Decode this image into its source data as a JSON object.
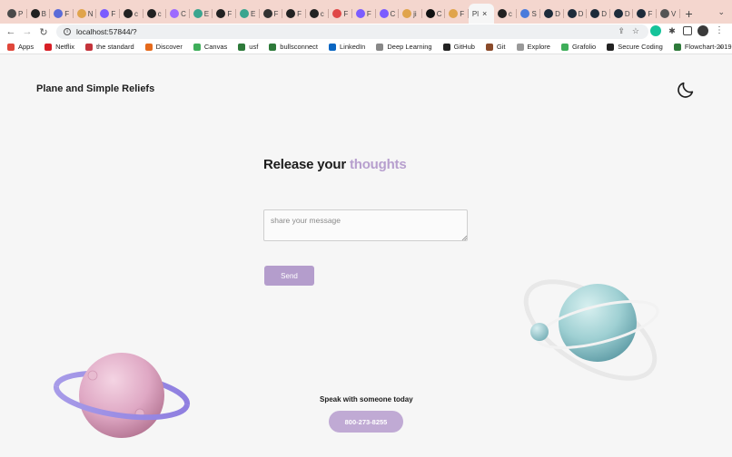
{
  "browser": {
    "tabs": [
      {
        "fav": "#4a4a4a",
        "label": "P"
      },
      {
        "fav": "#222222",
        "label": "B"
      },
      {
        "fav": "#5a6bd8",
        "label": "F"
      },
      {
        "fav": "#e0a44c",
        "label": "N"
      },
      {
        "fav": "#7b5cff",
        "label": "F"
      },
      {
        "fav": "#222222",
        "label": "c"
      },
      {
        "fav": "#222222",
        "label": "c"
      },
      {
        "fav": "#9d6bff",
        "label": "C"
      },
      {
        "fav": "#3aa58f",
        "label": "E"
      },
      {
        "fav": "#222222",
        "label": "F"
      },
      {
        "fav": "#3aa58f",
        "label": "E"
      },
      {
        "fav": "#333333",
        "label": "F"
      },
      {
        "fav": "#222222",
        "label": "F"
      },
      {
        "fav": "#222222",
        "label": "c"
      },
      {
        "fav": "#e04848",
        "label": "F"
      },
      {
        "fav": "#7b5cff",
        "label": "F"
      },
      {
        "fav": "#7b5cff",
        "label": "C"
      },
      {
        "fav": "#e0a44c",
        "label": "ji"
      },
      {
        "fav": "#111111",
        "label": "C"
      },
      {
        "fav": "#e0a44c",
        "label": "F"
      }
    ],
    "active_tab": {
      "label": "Pl",
      "close": "×"
    },
    "tabs_after": [
      {
        "fav": "#222222",
        "label": "c"
      },
      {
        "fav": "#4a7bdc",
        "label": "S"
      },
      {
        "fav": "#1d2b3a",
        "label": "D"
      },
      {
        "fav": "#1d2b3a",
        "label": "D"
      },
      {
        "fav": "#1d2b3a",
        "label": "D"
      },
      {
        "fav": "#1d2b3a",
        "label": "D"
      },
      {
        "fav": "#1d2b3a",
        "label": "F"
      },
      {
        "fav": "#555555",
        "label": "V"
      }
    ],
    "new_tab": "+",
    "tab_menu": "⌄",
    "url": "localhost:57844/?",
    "bookmarks": [
      {
        "label": "Apps",
        "color": "#e0473a"
      },
      {
        "label": "Netflix",
        "color": "#d81f26"
      },
      {
        "label": "the standard",
        "color": "#c4343b"
      },
      {
        "label": "Discover",
        "color": "#e56a1c"
      },
      {
        "label": "Canvas",
        "color": "#3fae5a"
      },
      {
        "label": "usf",
        "color": "#2e7a3a"
      },
      {
        "label": "bullsconnect",
        "color": "#2e7a3a"
      },
      {
        "label": "LinkedIn",
        "color": "#0a66c2"
      },
      {
        "label": "Deep Learning",
        "color": "#888888"
      },
      {
        "label": "GitHub",
        "color": "#222222"
      },
      {
        "label": "Git",
        "color": "#8a4a2a"
      },
      {
        "label": "Explore",
        "color": "#999999"
      },
      {
        "label": "Grafolio",
        "color": "#3fae5a"
      },
      {
        "label": "Secure Coding",
        "color": "#222222"
      },
      {
        "label": "Flowchart-2019",
        "color": "#2e7a3a"
      }
    ],
    "more": "»"
  },
  "page": {
    "brand": "Plane and Simple Reliefs",
    "headline_main": "Release your ",
    "headline_accent": "thoughts",
    "message_placeholder": "share your message",
    "message_value": "",
    "send_label": "Send",
    "speak_text": "Speak with someone today",
    "phone": "800-273-8255"
  },
  "colors": {
    "accent": "#b79fce",
    "button": "#b49dcc",
    "phone_button": "#c0aad4",
    "background": "#f6f6f6"
  }
}
